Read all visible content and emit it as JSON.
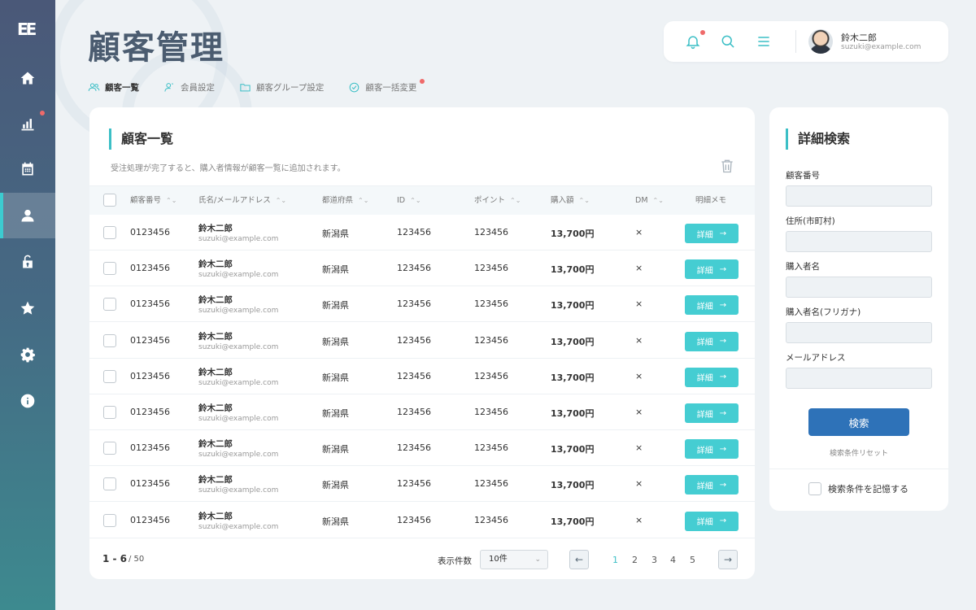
{
  "app": {
    "logo_text": "EE",
    "page_title": "顧客管理"
  },
  "user": {
    "name": "鈴木二郎",
    "email": "suzuki@example.com"
  },
  "header_icons": [
    "bell-icon",
    "search-icon",
    "menu-icon"
  ],
  "sidebar": {
    "items": [
      {
        "name": "home-icon"
      },
      {
        "name": "chart-icon",
        "has_notification": true
      },
      {
        "name": "calendar-icon"
      },
      {
        "name": "user-icon",
        "active": true
      },
      {
        "name": "lock-icon"
      },
      {
        "name": "star-icon"
      },
      {
        "name": "gear-icon"
      },
      {
        "name": "info-icon"
      }
    ]
  },
  "tabs": [
    {
      "label": "顧客一覧",
      "icon": "users-icon",
      "active": true
    },
    {
      "label": "会員設定",
      "icon": "user-settings-icon"
    },
    {
      "label": "顧客グループ設定",
      "icon": "folder-icon"
    },
    {
      "label": "顧客一括変更",
      "icon": "check-circle-icon",
      "has_notification": true
    }
  ],
  "customer_list": {
    "title": "顧客一覧",
    "description": "受注処理が完了すると、購入者情報が顧客一覧に追加されます。",
    "columns": [
      "顧客番号",
      "氏名/メールアドレス",
      "都道府県",
      "ID",
      "ポイント",
      "購入額",
      "DM",
      "明細メモ"
    ],
    "rows": [
      {
        "customer_no": "0123456",
        "name": "鈴木二郎",
        "email": "suzuki@example.com",
        "prefecture": "新潟県",
        "id": "123456",
        "points": "123456",
        "amount": "13,700円",
        "dm": "×",
        "action": "詳細"
      },
      {
        "customer_no": "0123456",
        "name": "鈴木二郎",
        "email": "suzuki@example.com",
        "prefecture": "新潟県",
        "id": "123456",
        "points": "123456",
        "amount": "13,700円",
        "dm": "×",
        "action": "詳細"
      },
      {
        "customer_no": "0123456",
        "name": "鈴木二郎",
        "email": "suzuki@example.com",
        "prefecture": "新潟県",
        "id": "123456",
        "points": "123456",
        "amount": "13,700円",
        "dm": "×",
        "action": "詳細"
      },
      {
        "customer_no": "0123456",
        "name": "鈴木二郎",
        "email": "suzuki@example.com",
        "prefecture": "新潟県",
        "id": "123456",
        "points": "123456",
        "amount": "13,700円",
        "dm": "×",
        "action": "詳細"
      },
      {
        "customer_no": "0123456",
        "name": "鈴木二郎",
        "email": "suzuki@example.com",
        "prefecture": "新潟県",
        "id": "123456",
        "points": "123456",
        "amount": "13,700円",
        "dm": "×",
        "action": "詳細"
      },
      {
        "customer_no": "0123456",
        "name": "鈴木二郎",
        "email": "suzuki@example.com",
        "prefecture": "新潟県",
        "id": "123456",
        "points": "123456",
        "amount": "13,700円",
        "dm": "×",
        "action": "詳細"
      },
      {
        "customer_no": "0123456",
        "name": "鈴木二郎",
        "email": "suzuki@example.com",
        "prefecture": "新潟県",
        "id": "123456",
        "points": "123456",
        "amount": "13,700円",
        "dm": "×",
        "action": "詳細"
      },
      {
        "customer_no": "0123456",
        "name": "鈴木二郎",
        "email": "suzuki@example.com",
        "prefecture": "新潟県",
        "id": "123456",
        "points": "123456",
        "amount": "13,700円",
        "dm": "×",
        "action": "詳細"
      },
      {
        "customer_no": "0123456",
        "name": "鈴木二郎",
        "email": "suzuki@example.com",
        "prefecture": "新潟県",
        "id": "123456",
        "points": "123456",
        "amount": "13,700円",
        "dm": "×",
        "action": "詳細"
      }
    ],
    "pagination": {
      "range": "1 - 6",
      "total": "/ 50",
      "per_page_label": "表示件数",
      "per_page_value": "10件",
      "pages": [
        "1",
        "2",
        "3",
        "4",
        "5"
      ],
      "current_page": "1"
    }
  },
  "advanced_search": {
    "title": "詳細検索",
    "fields": [
      {
        "label": "顧客番号",
        "value": ""
      },
      {
        "label": "住所(市町村)",
        "value": ""
      },
      {
        "label": "購入者名",
        "value": ""
      },
      {
        "label": "購入者名(フリガナ)",
        "value": ""
      },
      {
        "label": "メールアドレス",
        "value": ""
      }
    ],
    "search_button": "検索",
    "reset_link": "検索条件リセット",
    "remember_label": "検索条件を記憶する"
  },
  "colors": {
    "accent": "#3cbfc6",
    "primary_button": "#2e72b8",
    "notification": "#ef6a6a"
  }
}
